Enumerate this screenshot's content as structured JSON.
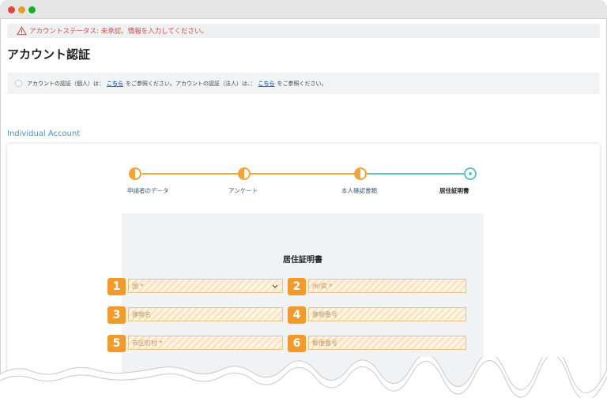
{
  "status_bar": {
    "text": "アカウントステータス: 未承認。情報を入力してください。",
    "icon": "warning-triangle-icon"
  },
  "page_title": "アカウント認証",
  "info_bar": {
    "part1": "アカウントの認証（個人）は：",
    "link1": "こちら",
    "part2": "をご参照ください。アカウントの認証（法人）は、：",
    "link2": "こちら",
    "part3": "をご参照ください。"
  },
  "section_label": "Individual Account",
  "stepper": {
    "steps": [
      {
        "label": "申請者のデータ",
        "state": "half"
      },
      {
        "label": "アンケート",
        "state": "half"
      },
      {
        "label": "本人確認書類",
        "state": "half"
      },
      {
        "label": "居住証明書",
        "state": "current"
      }
    ]
  },
  "form": {
    "title": "居住証明書",
    "fields": [
      {
        "badge": "1",
        "placeholder": "国 *"
      },
      {
        "badge": "2",
        "placeholder": "州/県 *"
      },
      {
        "badge": "3",
        "placeholder": "建物名"
      },
      {
        "badge": "4",
        "placeholder": "建物番号"
      },
      {
        "badge": "5",
        "placeholder": "市区町村 *"
      },
      {
        "badge": "6",
        "placeholder": "郵便番号"
      }
    ]
  },
  "colors": {
    "accent": "#f29b2c",
    "teal": "#5cc3c0",
    "link": "#1a6cd8",
    "warning": "#d04a4a"
  }
}
